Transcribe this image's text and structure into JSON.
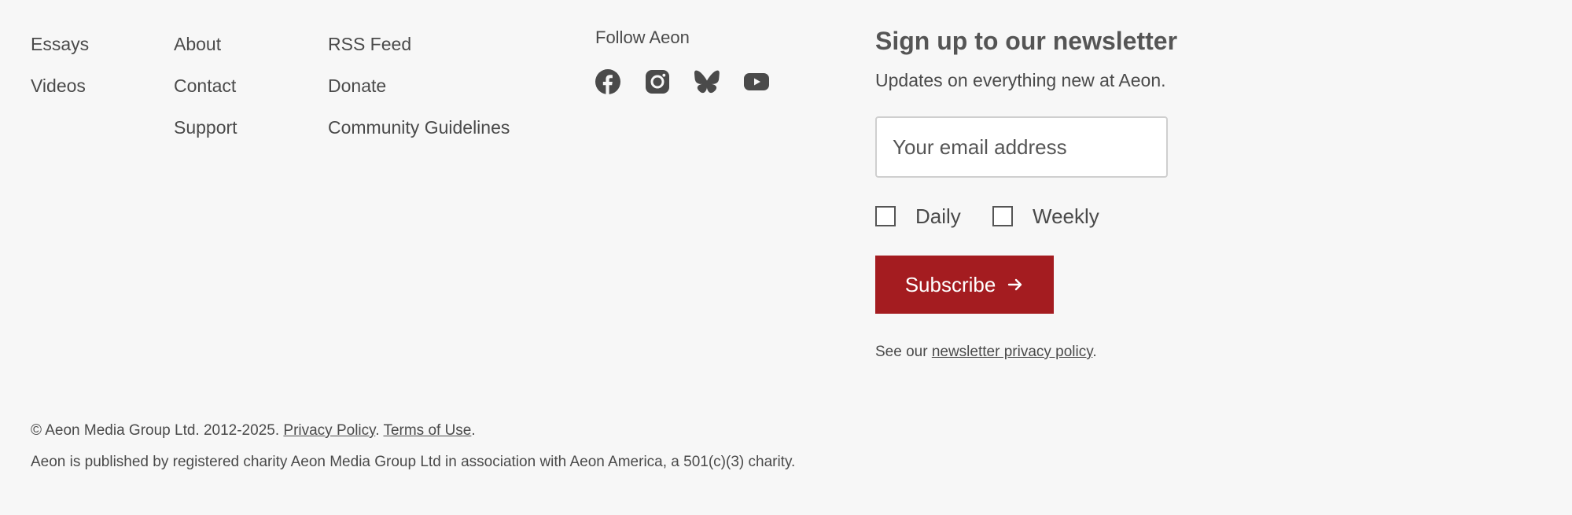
{
  "nav": {
    "col1": [
      {
        "label": "Essays"
      },
      {
        "label": "Videos"
      }
    ],
    "col2": [
      {
        "label": "About"
      },
      {
        "label": "Contact"
      },
      {
        "label": "Support"
      }
    ],
    "col3": [
      {
        "label": "RSS Feed"
      },
      {
        "label": "Donate"
      },
      {
        "label": "Community Guidelines"
      }
    ]
  },
  "follow": {
    "title": "Follow Aeon",
    "icons": [
      "facebook-icon",
      "instagram-icon",
      "bluesky-icon",
      "youtube-icon"
    ]
  },
  "newsletter": {
    "title": "Sign up to our newsletter",
    "subtitle": "Updates on everything new at Aeon.",
    "email_placeholder": "Your email address",
    "email_value": "",
    "options": [
      {
        "label": "Daily",
        "checked": false
      },
      {
        "label": "Weekly",
        "checked": false
      }
    ],
    "subscribe_label": "Subscribe",
    "privacy_prefix": "See our ",
    "privacy_link": "newsletter privacy policy",
    "privacy_suffix": "."
  },
  "footer": {
    "copyright_text": "© Aeon Media Group Ltd. 2012-2025. ",
    "privacy_link": "Privacy Policy",
    "separator": ". ",
    "terms_link": "Terms of Use",
    "terms_suffix": ".",
    "charity_text": "Aeon is published by registered charity Aeon Media Group Ltd in association with Aeon America, a 501(c)(3) charity."
  },
  "colors": {
    "background": "#f7f7f7",
    "text": "#4a4a4a",
    "accent": "#a41c20"
  }
}
